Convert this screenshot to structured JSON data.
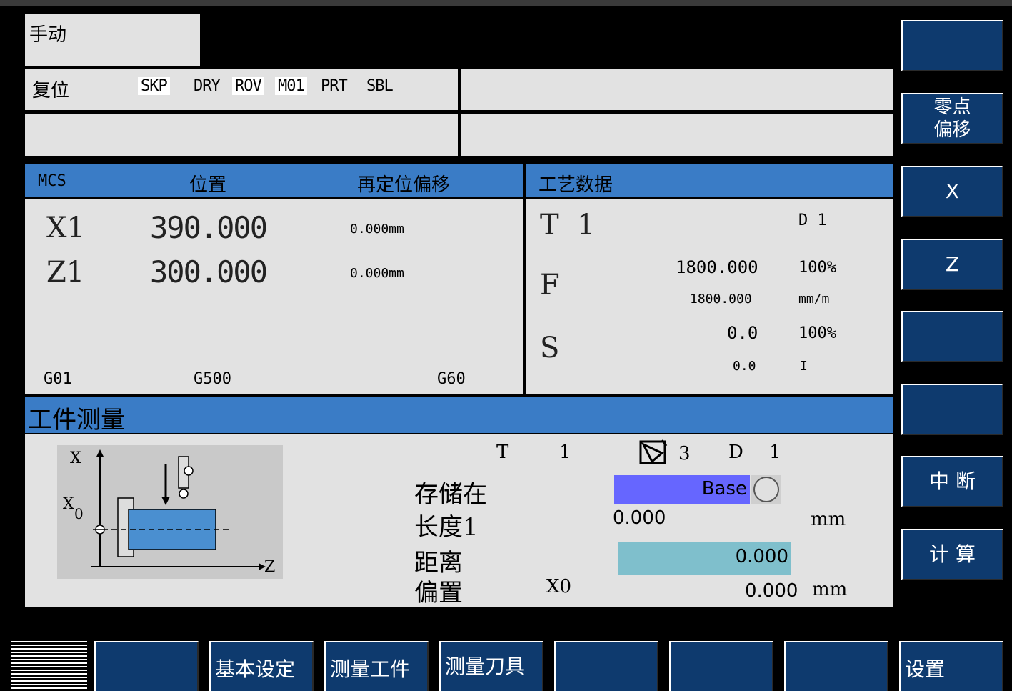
{
  "mode": "手动",
  "status": {
    "reset": "复位",
    "flags": [
      {
        "label": "SKP",
        "active": true
      },
      {
        "label": "DRY",
        "active": false
      },
      {
        "label": "ROV",
        "active": true
      },
      {
        "label": "M01",
        "active": true
      },
      {
        "label": "PRT",
        "active": false
      },
      {
        "label": "SBL",
        "active": false
      }
    ]
  },
  "mcs": {
    "header": {
      "coord": "MCS",
      "position": "位置",
      "offset": "再定位偏移"
    },
    "axes": [
      {
        "name": "X1",
        "value": "390.000",
        "offset": "0.000mm"
      },
      {
        "name": "Z1",
        "value": "300.000",
        "offset": "0.000mm"
      }
    ],
    "gcodes": [
      "G01",
      "G500",
      "G60"
    ]
  },
  "tech": {
    "header": "工艺数据",
    "t_label": "T",
    "t_value": "1",
    "d_label": "D 1",
    "f_label": "F",
    "f_value": "1800.000",
    "f_percent": "100%",
    "f_actual": "1800.000",
    "f_unit": "mm/m",
    "s_label": "S",
    "s_value": "0.0",
    "s_percent": "100%",
    "s_actual": "0.0",
    "s_unit": "I"
  },
  "measure": {
    "header": "工件测量",
    "t_label": "T",
    "t_value": "1",
    "edge_value": "3",
    "d_label": "D",
    "d_value": "1",
    "store_label": "存储在",
    "store_value": "Base",
    "length_label": "长度1",
    "length_value": "0.000",
    "length_unit": "mm",
    "dist_label": "距离",
    "dist_value": "0.000",
    "offset_label": "偏置",
    "offset_axis": "X0",
    "offset_value": "0.000",
    "offset_unit": "mm",
    "diagram": {
      "x_label": "X",
      "x0_label": "X",
      "x0_sub": "0",
      "z_label": "Z"
    }
  },
  "softkeys_right": [
    "",
    "零点\n偏移",
    "X",
    "Z",
    "",
    "",
    "中  断",
    "计  算"
  ],
  "softkeys_bottom": [
    "",
    "基本设定",
    "测量工件",
    "测量刀具",
    "",
    "",
    "",
    "设置"
  ],
  "colors": {
    "panel": "#e2e2e2",
    "header_blue": "#3a7cc6",
    "softkey_blue": "#0e3a6e",
    "store_field": "#6666ff",
    "dist_field": "#7fbfcc"
  }
}
